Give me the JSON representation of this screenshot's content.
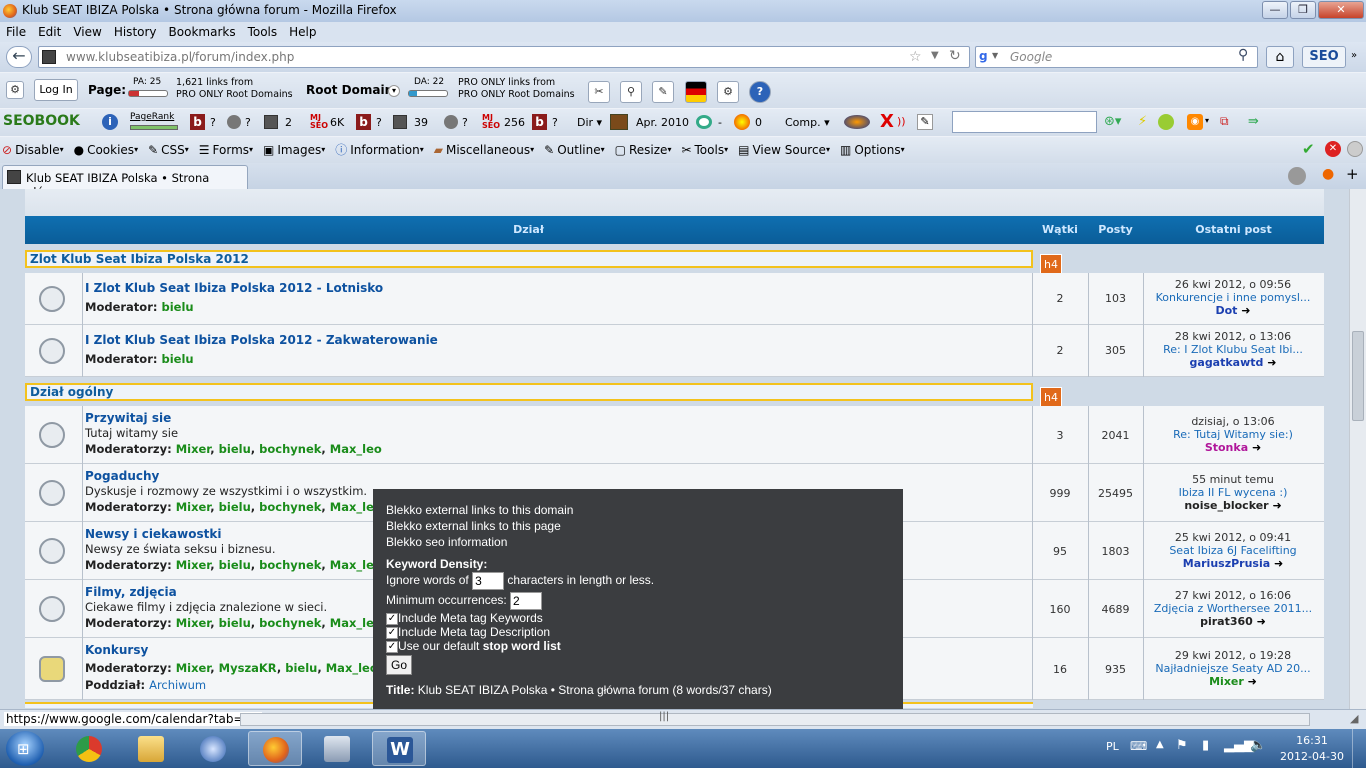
{
  "window": {
    "title": "Klub SEAT IBIZA Polska • Strona główna forum - Mozilla Firefox"
  },
  "menu": [
    "File",
    "Edit",
    "View",
    "History",
    "Bookmarks",
    "Tools",
    "Help"
  ],
  "nav": {
    "url_domain": "www.klubseatibiza.pl",
    "url_path": "/forum/index.php",
    "search_placeholder": "Google",
    "seo_label": "SEO"
  },
  "seomoz": {
    "login": "Log In",
    "page_label": "Page:",
    "pa": "PA: 25",
    "page_links": "1,621 links from",
    "page_links2": "PRO ONLY Root Domains",
    "root_label": "Root Domain:",
    "da": "DA: 22",
    "root_links": "PRO ONLY links from",
    "root_links2": "PRO ONLY Root Domains"
  },
  "seobook": {
    "logo": "SEOBOOK",
    "pagerank": "PageRank",
    "items": [
      "?",
      "?",
      "2",
      "6K",
      "?",
      "39",
      "?",
      "256",
      "?"
    ],
    "dir": "Dir",
    "date": "Apr. 2010",
    "dash": "-",
    "zero": "0",
    "comp": "Comp."
  },
  "devbar": [
    "Disable",
    "Cookies",
    "CSS",
    "Forms",
    "Images",
    "Information",
    "Miscellaneous",
    "Outline",
    "Resize",
    "Tools",
    "View Source",
    "Options"
  ],
  "tab": {
    "title": "Klub SEAT IBIZA Polska • Strona główna ..."
  },
  "forum": {
    "headers": {
      "section": "Dział",
      "threads": "Wątki",
      "posts": "Posty",
      "last": "Ostatni post"
    },
    "h4": "h4",
    "categories": [
      {
        "name": "Zlot Klub Seat Ibiza Polska 2012",
        "rows": [
          {
            "title": "I Zlot Klub Seat Ibiza Polska 2012 - Lotnisko",
            "desc": "",
            "mod_label": "Moderator:",
            "mods": [
              "bielu"
            ],
            "threads": "2",
            "posts": "103",
            "date": "26 kwi 2012, o 09:56",
            "topic": "Konkurencje i inne pomysl...",
            "author": "Dot",
            "author_color": "#1b3fb0"
          },
          {
            "title": "I Zlot Klub Seat Ibiza Polska 2012 - Zakwaterowanie",
            "desc": "",
            "mod_label": "Moderator:",
            "mods": [
              "bielu"
            ],
            "threads": "2",
            "posts": "305",
            "date": "28 kwi 2012, o 13:06",
            "topic": "Re: I Zlot Klubu Seat Ibi...",
            "author": "gagatkawtd",
            "author_color": "#1b3fb0"
          }
        ]
      },
      {
        "name": "Dział ogólny",
        "rows": [
          {
            "title": "Przywitaj sie",
            "desc": "Tutaj witamy sie",
            "mod_label": "Moderatorzy:",
            "mods": [
              "Mixer",
              "bielu",
              "bochynek",
              "Max_leo"
            ],
            "threads": "3",
            "posts": "2041",
            "date": "dzisiaj, o 13:06",
            "topic": "Re: Tutaj Witamy sie:)",
            "author": "Stonka",
            "author_color": "#b0169a"
          },
          {
            "title": "Pogaduchy",
            "desc": "Dyskusje i rozmowy ze wszystkimi i o wszystkim.",
            "mod_label": "Moderatorzy:",
            "mods": [
              "Mixer",
              "bielu",
              "bochynek",
              "Max_leo"
            ],
            "threads": "999",
            "posts": "25495",
            "date": "55 minut temu",
            "topic": "Ibiza II FL wycena :)",
            "author": "noise_blocker",
            "author_color": "#222222"
          },
          {
            "title": "Newsy i ciekawostki",
            "desc": "Newsy ze świata seksu i biznesu.",
            "mod_label": "Moderatorzy:",
            "mods": [
              "Mixer",
              "bielu",
              "bochynek",
              "Max_leo"
            ],
            "threads": "95",
            "posts": "1803",
            "date": "25 kwi 2012, o 09:41",
            "topic": "Seat Ibiza 6J Facelifting",
            "author": "MariuszPrusia",
            "author_color": "#1b3fb0"
          },
          {
            "title": "Filmy, zdjęcia",
            "desc": "Ciekawe filmy i zdjęcia znalezione w sieci.",
            "mod_label": "Moderatorzy:",
            "mods": [
              "Mixer",
              "bielu",
              "bochynek",
              "Max_leo"
            ],
            "threads": "160",
            "posts": "4689",
            "date": "27 kwi 2012, o 16:06",
            "topic": "Zdjęcia z Worthersee 2011...",
            "author": "pirat360",
            "author_color": "#222222"
          },
          {
            "title": "Konkursy",
            "desc": "",
            "mod_label": "Moderatorzy:",
            "mods": [
              "Mixer",
              "MyszaKR",
              "bielu",
              "Max_leo"
            ],
            "sub_label": "Poddział:",
            "sub": "Archiwum",
            "threads": "16",
            "posts": "935",
            "date": "29 kwi 2012, o 19:28",
            "topic": "Najładniejsze Seaty AD 20...",
            "author": "Mixer",
            "author_color": "#1a8c1a"
          }
        ]
      }
    ]
  },
  "tooltip": {
    "line1": "Blekko external links to this domain",
    "line2": "Blekko external links to this page",
    "line3": "Blekko seo information",
    "kd_title": "Keyword Density:",
    "ignore_pre": "Ignore words of",
    "ignore_val": "3",
    "ignore_post": "characters in length or less.",
    "min_label": "Minimum occurrences:",
    "min_val": "2",
    "chk1": "Include Meta tag Keywords",
    "chk2": "Include Meta tag Description",
    "chk3_pre": "Use our default",
    "chk3_bold": "stop word list",
    "go": "Go",
    "title_label": "Title:",
    "title_val": "Klub SEAT IBIZA Polska • Strona główna forum (8 words/37 chars)"
  },
  "status": {
    "url": "https://www.google.com/calendar?tab=wc"
  },
  "taskbar": {
    "lang": "PL",
    "time": "16:31",
    "date": "2012-04-30"
  }
}
